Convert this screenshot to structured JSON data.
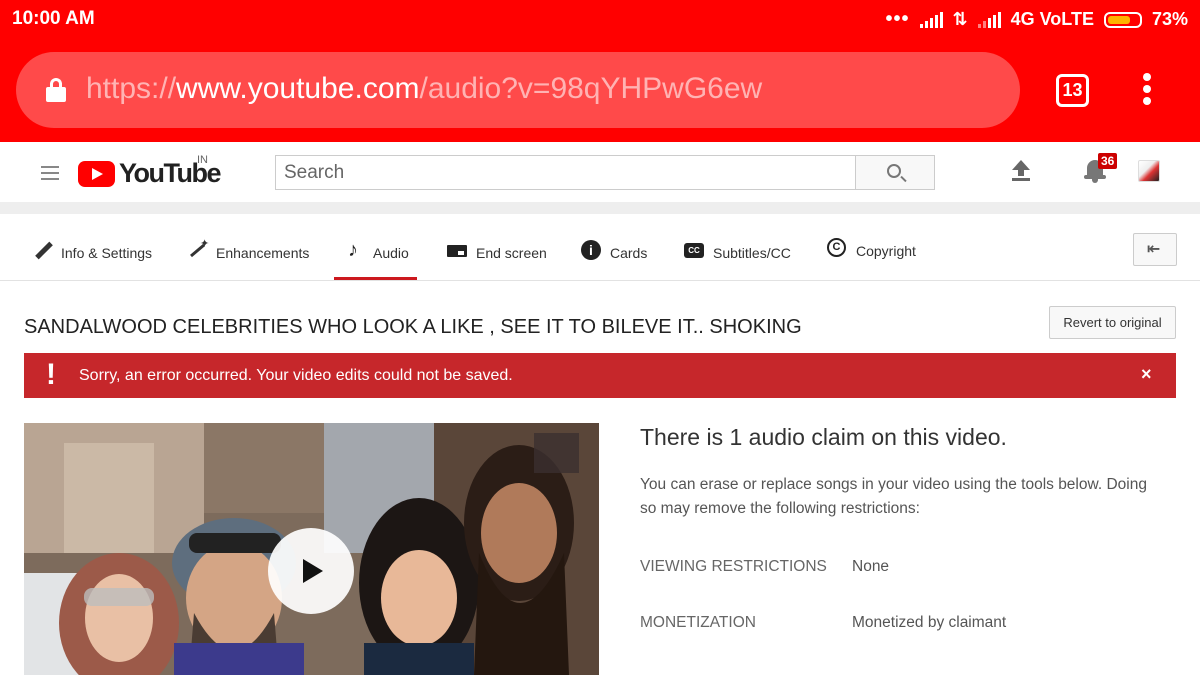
{
  "status_bar": {
    "time": "10:00 AM",
    "network": "4G VoLTE",
    "battery": "73%",
    "battery_level": 0.73
  },
  "browser": {
    "url_scheme": "https://",
    "url_host": "www.youtube.com",
    "url_path": "/audio?v=98qYHPwG6ew",
    "tab_count": "13",
    "icons": [
      "lock-icon",
      "tab-switcher-icon",
      "overflow-menu-icon"
    ]
  },
  "header": {
    "logo_text": "YouTube",
    "region": "IN",
    "search_placeholder": "Search",
    "notification_count": "36",
    "icons": [
      "menu-icon",
      "search-icon",
      "upload-icon",
      "bell-icon",
      "avatar"
    ]
  },
  "tabs": [
    {
      "label": "Info & Settings",
      "icon": "pencil-icon"
    },
    {
      "label": "Enhancements",
      "icon": "magic-wand-icon"
    },
    {
      "label": "Audio",
      "icon": "music-note-icon",
      "active": true
    },
    {
      "label": "End screen",
      "icon": "end-screen-icon"
    },
    {
      "label": "Cards",
      "icon": "info-icon"
    },
    {
      "label": "Subtitles/CC",
      "icon": "cc-icon"
    },
    {
      "label": "Copyright",
      "icon": "copyright-icon"
    }
  ],
  "page": {
    "video_title": "SANDALWOOD CELEBRITIES WHO LOOK A LIKE , SEE IT TO BILEVE IT.. SHOKING",
    "revert_label": "Revert to original",
    "error_message": "Sorry, an error occurred. Your video edits could not be saved.",
    "error_close": "×"
  },
  "claim": {
    "heading": "There is 1 audio claim on this video.",
    "description": "You can erase or replace songs in your video using the tools below. Doing so may remove the following restrictions:",
    "rows": [
      {
        "label": "VIEWING RESTRICTIONS",
        "value": "None"
      },
      {
        "label": "MONETIZATION",
        "value": "Monetized by claimant"
      }
    ]
  },
  "colors": {
    "browser_red": "#ff0000",
    "error_red": "#c6272b",
    "tab_underline": "#cc181e"
  }
}
